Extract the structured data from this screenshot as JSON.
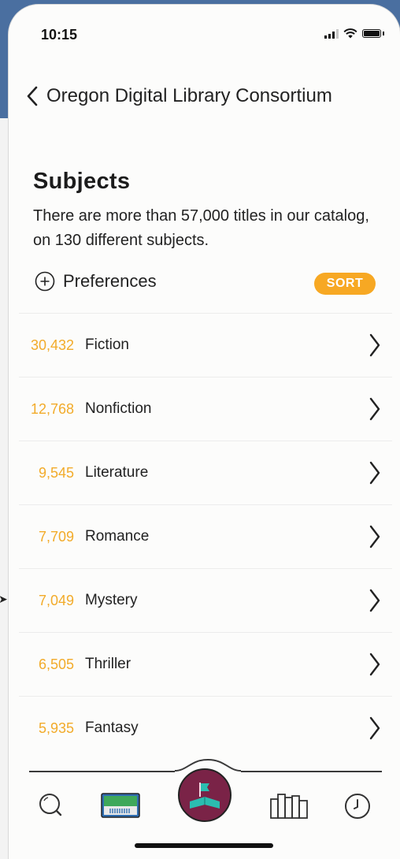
{
  "status": {
    "time": "10:15"
  },
  "nav": {
    "title": "Oregon Digital Library Consortium",
    "back_icon": "chevron-left-icon"
  },
  "section": {
    "title": "Subjects",
    "description": "There are more than 57,000 titles in our catalog, on 130 different subjects."
  },
  "controls": {
    "preferences_label": "Preferences",
    "sort_label": "SORT"
  },
  "colors": {
    "accent": "#f7a823",
    "count": "#f2ab2a",
    "libby": "#7a2347",
    "teal": "#2bbdb0"
  },
  "subjects": [
    {
      "count": "30,432",
      "name": "Fiction"
    },
    {
      "count": "12,768",
      "name": "Nonfiction"
    },
    {
      "count": "9,545",
      "name": "Literature"
    },
    {
      "count": "7,709",
      "name": "Romance"
    },
    {
      "count": "7,049",
      "name": "Mystery"
    },
    {
      "count": "6,505",
      "name": "Thriller"
    },
    {
      "count": "5,935",
      "name": "Fantasy"
    }
  ],
  "tabs": [
    {
      "icon": "search-icon"
    },
    {
      "icon": "library-card-icon"
    },
    {
      "icon": "libby-home-icon"
    },
    {
      "icon": "shelf-icon"
    },
    {
      "icon": "timeline-clock-icon"
    }
  ]
}
